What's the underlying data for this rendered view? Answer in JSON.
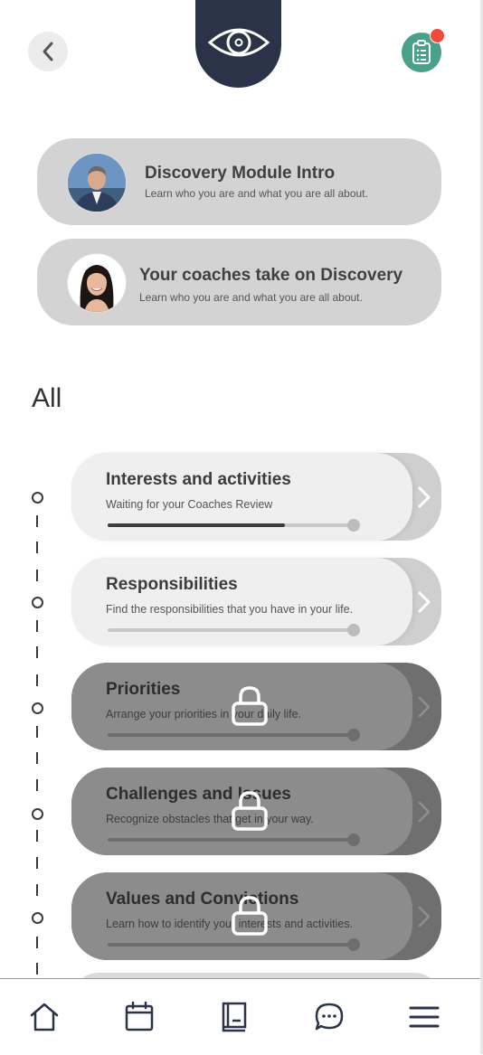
{
  "header": {
    "back_icon": "chevron-left-icon",
    "module_icon": "eye-icon",
    "tasks_icon": "clipboard-icon",
    "has_notification": true,
    "colors": {
      "eye_tab": "#2b3348",
      "clipboard": "#4aa08b",
      "notification": "#f04a3a"
    }
  },
  "intro_cards": [
    {
      "title": "Discovery Module Intro",
      "subtitle": "Learn who you are and what you are all about."
    },
    {
      "title": "Your coaches take on Discovery",
      "subtitle": "Learn who you are and what you are all about."
    }
  ],
  "section_heading": "All",
  "modules": [
    {
      "title": "Interests and activities",
      "subtitle": "Waiting for your Coaches Review",
      "progress": 0.72,
      "locked": false
    },
    {
      "title": "Responsibilities",
      "subtitle": "Find the responsibilities that you have in your life.",
      "progress": 0,
      "locked": false
    },
    {
      "title": "Priorities",
      "subtitle": "Arrange your priorities in your daily life.",
      "progress": 0,
      "locked": true
    },
    {
      "title": "Challenges and Issues",
      "subtitle": "Recognize obstacles that get in your way.",
      "progress": 0,
      "locked": true
    },
    {
      "title": "Values and Convictions",
      "subtitle": "Learn how to identify your interests and activities.",
      "progress": 0,
      "locked": true
    }
  ],
  "bottom_nav": [
    "home-icon",
    "calendar-icon",
    "book-icon",
    "chat-icon",
    "menu-icon"
  ]
}
